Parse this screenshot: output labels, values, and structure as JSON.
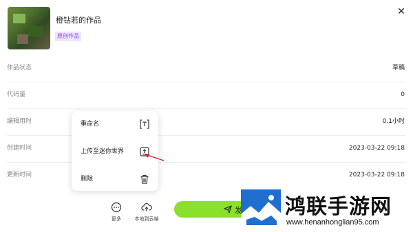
{
  "header": {
    "title": "橙钻若的作品",
    "badge": "原创作品",
    "close_glyph": "✕"
  },
  "details": [
    {
      "label": "作品状态",
      "value": "草稿"
    },
    {
      "label": "代码量",
      "value": "0"
    },
    {
      "label": "编辑用时",
      "value": "0.1小时"
    },
    {
      "label": "创建时间",
      "value": "2023-03-22 09:18"
    },
    {
      "label": "更新时间",
      "value": "2023-03-22 09:18"
    }
  ],
  "context_menu": {
    "items": [
      {
        "label": "重命名",
        "icon": "rename-icon"
      },
      {
        "label": "上传至迷你世界",
        "icon": "upload-box-icon"
      },
      {
        "label": "删除",
        "icon": "trash-icon"
      }
    ]
  },
  "bottom_bar": {
    "more_label": "更多",
    "upload_label": "本地到云端",
    "publish_label": "发"
  },
  "watermark": {
    "text": "鸿联手游网",
    "url": "www.henanhonglian95.com"
  },
  "colors": {
    "accent": "#8be02b",
    "badge_text": "#8a4fe0",
    "badge_bg": "#efe5ff",
    "annotation_arrow": "#e02020"
  }
}
